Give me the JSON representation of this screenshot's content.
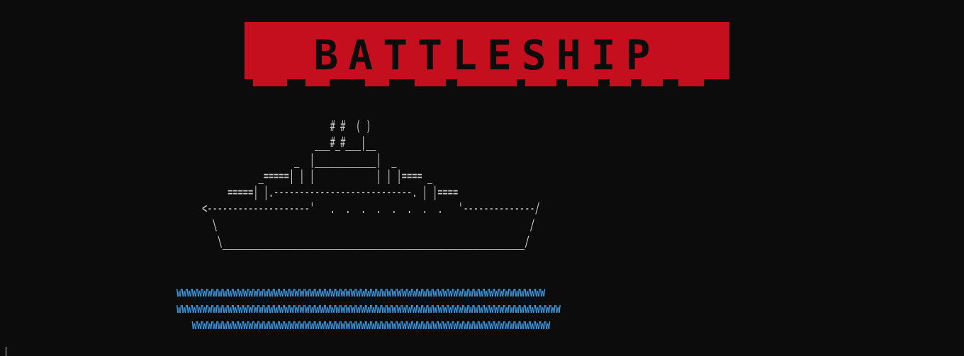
{
  "banner": {
    "title": "BATTLESHIP",
    "color": "#c50f1f",
    "text_color": "#0c0c0c"
  },
  "ship": {
    "lines": [
      "                                ( )",
      "                         # #  ( )",
      "                      ___#_#___|__",
      "                  _  |____________|  _",
      "           _=====| | |            | | |==== _",
      "     =====| |.---------------------------. | |====",
      "<--------------------'   .  .  .  .  .  .  .  .   '--------------/",
      "  \\                                                             /",
      "   \\___________________________________________________________/"
    ]
  },
  "water": {
    "color": "#3a96dd",
    "lines": [
      "wwwwwwwwwwwwwwwwwwwwwwwwwwwwwwwwwwwwwwwwwwwwwwwwwwwwwwwwwwwwwwwwwwwwwwww",
      "wwwwwwwwwwwwwwwwwwwwwwwwwwwwwwwwwwwwwwwwwwwwwwwwwwwwwwwwwwwwwwwwwwwwwwwwwww",
      "   wwwwwwwwwwwwwwwwwwwwwwwwwwwwwwwwwwwwwwwwwwwwwwwwwwwwwwwwwwwwwwwwwwwwww"
    ]
  },
  "terminal": {
    "background": "#0c0c0c",
    "foreground": "#cccccc"
  }
}
